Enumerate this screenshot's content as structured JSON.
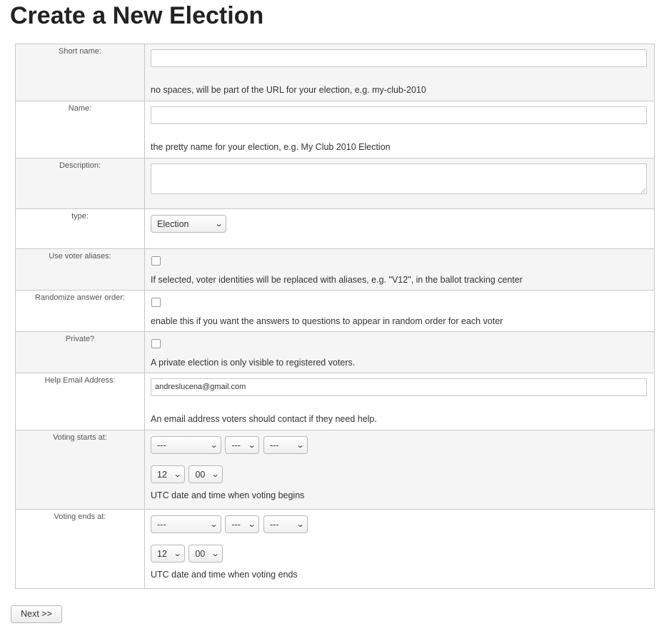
{
  "page": {
    "title": "Create a New Election"
  },
  "form": {
    "short_name": {
      "label": "Short name:",
      "value": "",
      "help": "no spaces, will be part of the URL for your election, e.g. my-club-2010"
    },
    "name": {
      "label": "Name:",
      "value": "",
      "help": "the pretty name for your election, e.g. My Club 2010 Election"
    },
    "description": {
      "label": "Description:",
      "value": ""
    },
    "type": {
      "label": "type:",
      "selected": "Election"
    },
    "use_voter_aliases": {
      "label": "Use voter aliases:",
      "checked": false,
      "help": "If selected, voter identities will be replaced with aliases, e.g. \"V12\", in the ballot tracking center"
    },
    "randomize_answer_order": {
      "label": "Randomize answer order:",
      "checked": false,
      "help": "enable this if you want the answers to questions to appear in random order for each voter"
    },
    "private": {
      "label": "Private?",
      "checked": false,
      "help": "A private election is only visible to registered voters."
    },
    "help_email": {
      "label": "Help Email Address:",
      "value": "andreslucena@gmail.com",
      "help": "An email address voters should contact if they need help."
    },
    "voting_starts_at": {
      "label": "Voting starts at:",
      "month": "---",
      "day": "---",
      "year": "---",
      "hour": "12",
      "minute": "00",
      "help": "UTC date and time when voting begins"
    },
    "voting_ends_at": {
      "label": "Voting ends at:",
      "month": "---",
      "day": "---",
      "year": "---",
      "hour": "12",
      "minute": "00",
      "help": "UTC date and time when voting ends"
    }
  },
  "buttons": {
    "next": "Next >>"
  },
  "icons": {
    "dropdown": "chevron-down-icon",
    "resize": "resize-grip-icon"
  }
}
